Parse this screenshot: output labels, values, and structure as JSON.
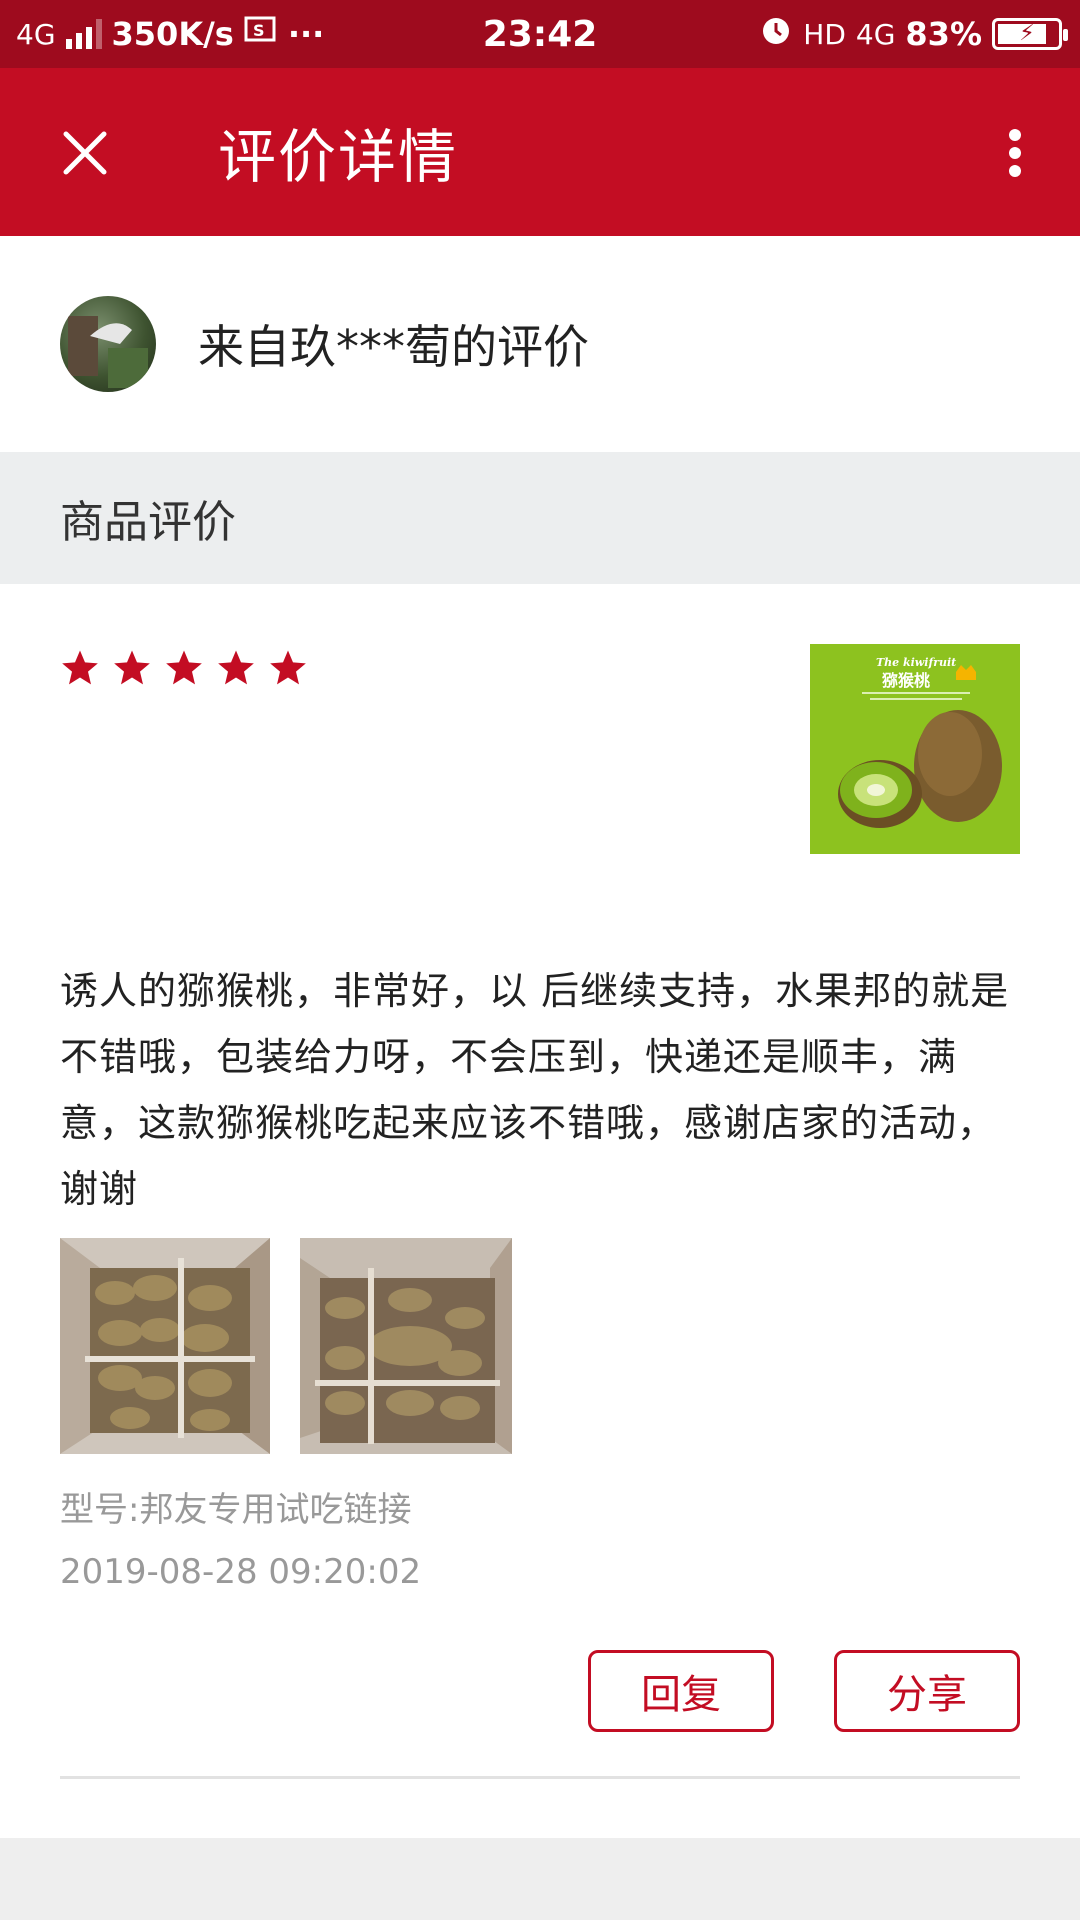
{
  "status_bar": {
    "network": "4G",
    "speed": "350K/s",
    "more": "···",
    "time": "23:42",
    "hd": "HD",
    "net_right": "4G",
    "battery": "83%",
    "battery_level": 0.83
  },
  "app_bar": {
    "title": "评价详情",
    "close_icon": "close-icon",
    "more_icon": "more-vert-icon",
    "color": "#c30d23"
  },
  "reviewer": {
    "name": "来自玖***萄的评价"
  },
  "section": {
    "title": "商品评价"
  },
  "review": {
    "rating": 5,
    "max_rating": 5,
    "star_color": "#c30d23",
    "text": "诱人的猕猴桃，非常好，以 后继续支持，水果邦的就是不错哦，包装给力呀，不会压到，快递还是顺丰，满意，这款猕猴桃吃起来应该不错哦，感谢店家的活动，谢谢",
    "model": "型号:邦友专用试吃链接",
    "time": "2019-08-28 09:20:02"
  },
  "product_image": {
    "caption_en": "The kiwifruit",
    "caption_cn": "猕猴桃",
    "bg_color": "#8dc21f"
  },
  "actions": {
    "reply_label": "回复",
    "share_label": "分享"
  }
}
